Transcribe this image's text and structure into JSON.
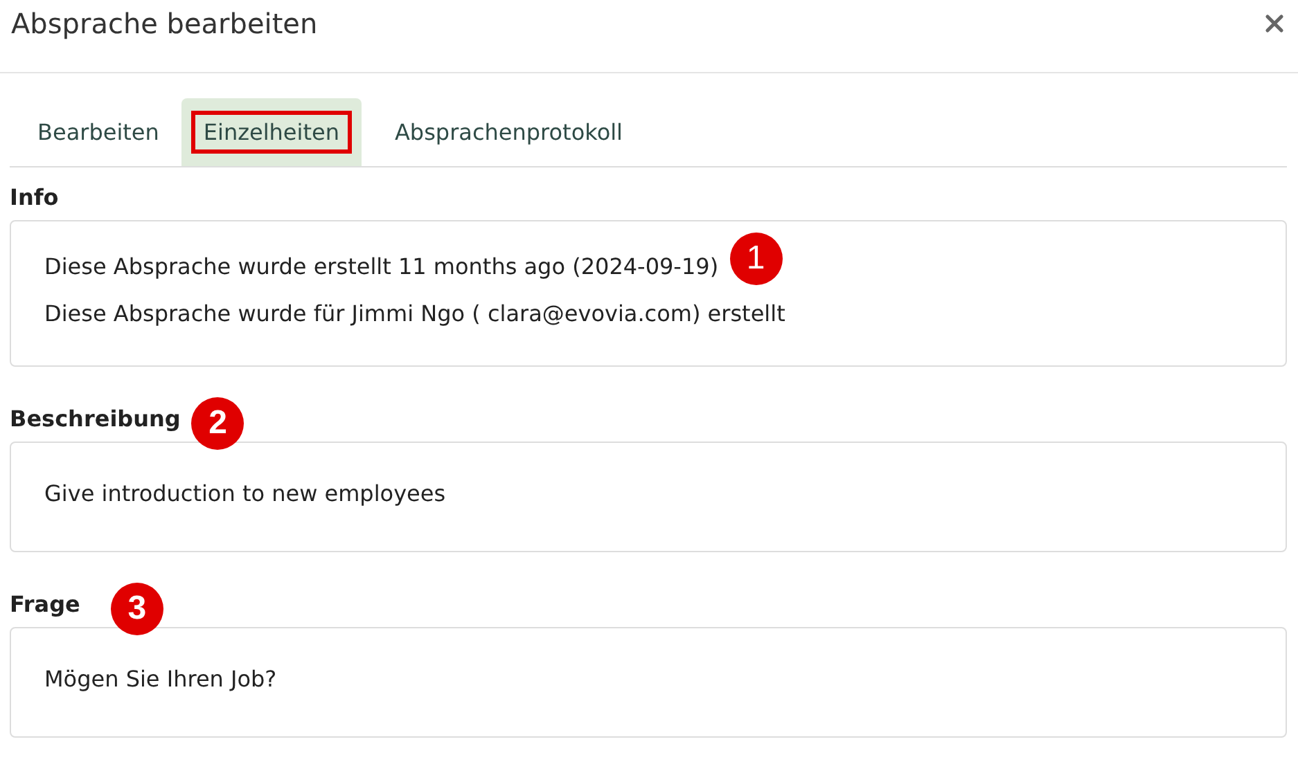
{
  "dialog": {
    "title": "Absprache bearbeiten"
  },
  "tabs": [
    {
      "label": "Bearbeiten",
      "selected": false,
      "highlighted": false
    },
    {
      "label": "Einzelheiten",
      "selected": true,
      "highlighted": true
    },
    {
      "label": "Absprachenprotokoll",
      "selected": false,
      "highlighted": false
    }
  ],
  "sections": [
    {
      "label": "Info",
      "lines": [
        "Diese Absprache wurde erstellt 11 months ago (2024-09-19)",
        "Diese Absprache wurde für Jimmi Ngo ( clara@evovia.com) erstellt"
      ],
      "marker": "1",
      "kind": "inline"
    },
    {
      "label": "Beschreibung",
      "lines": [
        "Give introduction to new employees"
      ],
      "marker": "2",
      "kind": "heading"
    },
    {
      "label": "Frage",
      "lines": [
        "Mögen Sie Ihren Job?"
      ],
      "marker": "3",
      "kind": "heading"
    }
  ]
}
